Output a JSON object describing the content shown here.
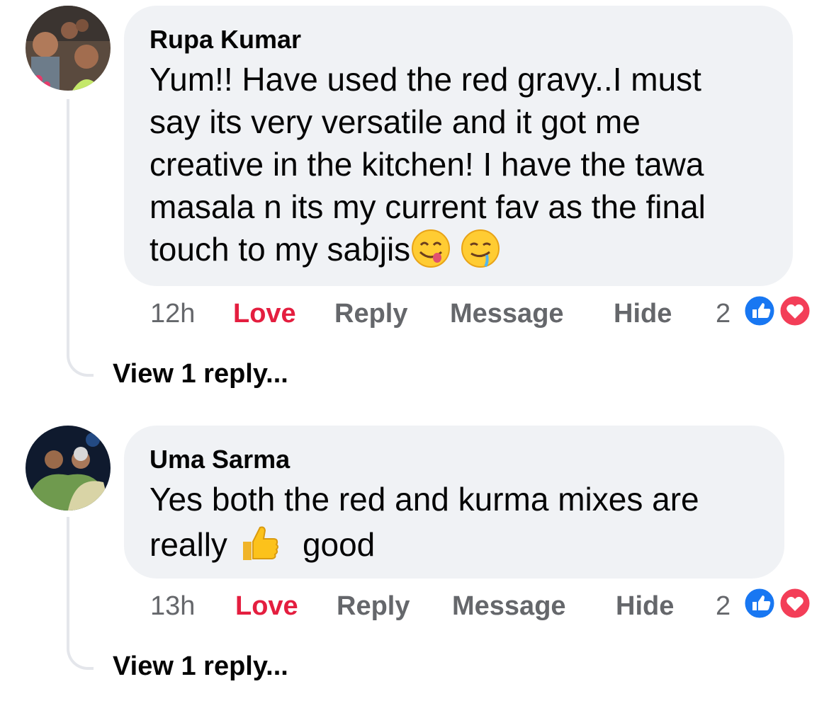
{
  "comments": [
    {
      "author": "Rupa Kumar",
      "text_parts": [
        "Yum!! Have used the red gravy..I must",
        "say its very versatile and it got me",
        "creative in the kitchen! I have the tawa",
        "masala n its my current fav as the final",
        "touch to my sabjis"
      ],
      "emojis": [
        "yum-face-icon",
        "drooling-face-icon"
      ],
      "time": "12h",
      "actions": {
        "love": "Love",
        "reply": "Reply",
        "message": "Message",
        "hide": "Hide"
      },
      "reaction_count": "2",
      "reactions": [
        "like-reaction-icon",
        "love-reaction-icon"
      ],
      "view_replies": "View 1 reply..."
    },
    {
      "author": "Uma Sarma",
      "text_parts": [
        "Yes both the red and kurma mixes are",
        "really",
        "good"
      ],
      "emojis": [
        "thumbs-up-icon"
      ],
      "time": "13h",
      "actions": {
        "love": "Love",
        "reply": "Reply",
        "message": "Message",
        "hide": "Hide"
      },
      "reaction_count": "2",
      "reactions": [
        "like-reaction-icon",
        "love-reaction-icon"
      ],
      "view_replies": "View 1 reply..."
    }
  ],
  "colors": {
    "bubble": "#f0f2f5",
    "love_action": "#e41e3f",
    "secondary_text": "#65676b",
    "like_blue": "#1877f2",
    "love_red": "#f33e58"
  }
}
